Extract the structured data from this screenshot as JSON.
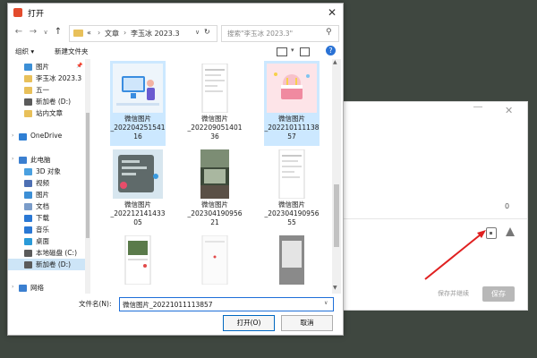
{
  "background_window": {
    "zero_value": "0",
    "save_and_continue_label": "保存并继续",
    "save_label": "保存"
  },
  "dialog": {
    "title": "打开",
    "close_glyph": "✕",
    "nav": {
      "back": "←",
      "forward": "→",
      "dropdown": "∨",
      "up": "↑",
      "refresh": "↻"
    },
    "breadcrumb": [
      "«",
      "文章",
      "李玉冰 2023.3"
    ],
    "search_placeholder": "搜索\"李玉冰 2023.3\"",
    "toolbar": {
      "organize": "组织 ▾",
      "new_folder": "新建文件夹",
      "help": "?"
    },
    "sidebar": [
      {
        "label": "图片",
        "icon": "picture-icon",
        "color": "#3c8fd6",
        "indent": 1,
        "pinned": true
      },
      {
        "label": "李玉冰 2023.3",
        "icon": "folder-icon",
        "color": "#e8c05a",
        "indent": 1
      },
      {
        "label": "五一",
        "icon": "folder-icon",
        "color": "#e8c05a",
        "indent": 1
      },
      {
        "label": "新加卷 (D:)",
        "icon": "drive-icon",
        "color": "#5b5b5b",
        "indent": 1
      },
      {
        "label": "站内文章",
        "icon": "folder-icon",
        "color": "#e8c05a",
        "indent": 1
      },
      {
        "label": "",
        "icon": "",
        "color": "",
        "indent": 0
      },
      {
        "label": "OneDrive",
        "icon": "cloud-icon",
        "color": "#2f7fd4",
        "indent": 0,
        "expander": true
      },
      {
        "label": "",
        "icon": "",
        "color": "",
        "indent": 0
      },
      {
        "label": "此电脑",
        "icon": "computer-icon",
        "color": "#3b7fd0",
        "indent": 0,
        "expander": true
      },
      {
        "label": "3D 对象",
        "icon": "cube-icon",
        "color": "#4aa0e0",
        "indent": 1
      },
      {
        "label": "视频",
        "icon": "video-icon",
        "color": "#4d6fb3",
        "indent": 1
      },
      {
        "label": "图片",
        "icon": "picture-icon",
        "color": "#3c8fd6",
        "indent": 1
      },
      {
        "label": "文档",
        "icon": "document-icon",
        "color": "#7a9cc9",
        "indent": 1
      },
      {
        "label": "下载",
        "icon": "download-icon",
        "color": "#2a78d4",
        "indent": 1
      },
      {
        "label": "音乐",
        "icon": "music-icon",
        "color": "#2a78d4",
        "indent": 1
      },
      {
        "label": "桌面",
        "icon": "desktop-icon",
        "color": "#2a9ad8",
        "indent": 1
      },
      {
        "label": "本地磁盘 (C:)",
        "icon": "drive-icon",
        "color": "#5b5b5b",
        "indent": 1
      },
      {
        "label": "新加卷 (D:)",
        "icon": "drive-icon",
        "color": "#5b5b5b",
        "indent": 1,
        "selected": true
      },
      {
        "label": "",
        "icon": "",
        "color": "",
        "indent": 0
      },
      {
        "label": "网络",
        "icon": "network-icon",
        "color": "#3b7fd0",
        "indent": 0,
        "expander": true
      }
    ],
    "files": [
      {
        "line1": "微信图片",
        "line2": "_202204251541",
        "line3": "16",
        "selected": true,
        "kind": "illustration-monitor"
      },
      {
        "line1": "微信图片",
        "line2": "_202209051401",
        "line3": "36",
        "selected": false,
        "kind": "phone-screenshot"
      },
      {
        "line1": "微信图片",
        "line2": "_202210111138",
        "line3": "57",
        "selected": true,
        "kind": "illustration-cake"
      },
      {
        "line1": "微信图片",
        "line2": "_202212141433",
        "line3": "05",
        "selected": false,
        "kind": "dark-chat"
      },
      {
        "line1": "微信图片",
        "line2": "_202304190956",
        "line3": "21",
        "selected": false,
        "kind": "photo-outdoor"
      },
      {
        "line1": "微信图片",
        "line2": "_202304190956",
        "line3": "55",
        "selected": false,
        "kind": "phone-screenshot"
      },
      {
        "line1": "",
        "line2": "",
        "line3": "",
        "selected": false,
        "kind": "phone-photo"
      },
      {
        "line1": "",
        "line2": "",
        "line3": "",
        "selected": false,
        "kind": "phone-blank"
      },
      {
        "line1": "",
        "line2": "",
        "line3": "",
        "selected": false,
        "kind": "phone-gray"
      }
    ],
    "filename_label": "文件名(N):",
    "filename_value": "微信图片_20221011113857",
    "open_button": "打开(O)",
    "cancel_button": "取消"
  },
  "colors": {
    "selection": "#cce8ff",
    "accent": "#0067c0",
    "arrow": "#e02020"
  }
}
